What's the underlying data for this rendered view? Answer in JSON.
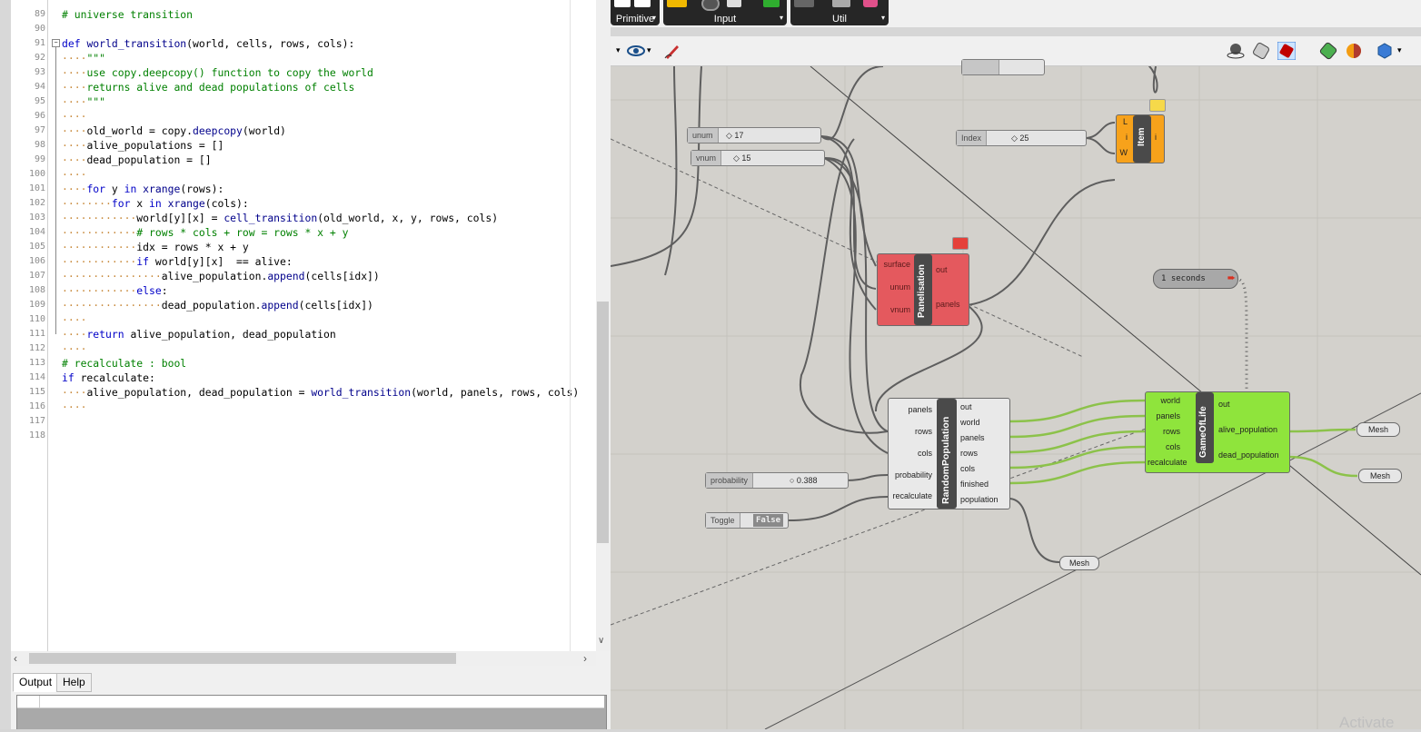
{
  "editor": {
    "lines": [
      {
        "n": "89",
        "code": [
          [
            "cm",
            "# universe transition"
          ]
        ]
      },
      {
        "n": "90",
        "code": []
      },
      {
        "n": "91",
        "code": [
          [
            "kw",
            "def "
          ],
          [
            "fn",
            "world_transition"
          ],
          [
            "",
            "(world, cells, rows, cols):"
          ]
        ]
      },
      {
        "n": "92",
        "code": [
          [
            "ws",
            "····"
          ],
          [
            "st",
            "\"\"\""
          ]
        ]
      },
      {
        "n": "93",
        "code": [
          [
            "ws",
            "····"
          ],
          [
            "cm",
            "use copy.deepcopy() function to copy the world"
          ]
        ]
      },
      {
        "n": "94",
        "code": [
          [
            "ws",
            "····"
          ],
          [
            "cm",
            "returns alive and dead populations of cells"
          ]
        ]
      },
      {
        "n": "95",
        "code": [
          [
            "ws",
            "····"
          ],
          [
            "st",
            "\"\"\""
          ]
        ]
      },
      {
        "n": "96",
        "code": [
          [
            "ws",
            "····"
          ]
        ]
      },
      {
        "n": "97",
        "code": [
          [
            "ws",
            "····"
          ],
          [
            "",
            "old_world = copy."
          ],
          [
            "fn",
            "deepcopy"
          ],
          [
            "",
            "(world)"
          ]
        ]
      },
      {
        "n": "98",
        "code": [
          [
            "ws",
            "····"
          ],
          [
            "",
            "alive_populations = []"
          ]
        ]
      },
      {
        "n": "99",
        "code": [
          [
            "ws",
            "····"
          ],
          [
            "",
            "dead_population = []"
          ]
        ]
      },
      {
        "n": "100",
        "code": [
          [
            "ws",
            "····"
          ]
        ]
      },
      {
        "n": "101",
        "code": [
          [
            "ws",
            "····"
          ],
          [
            "kw",
            "for"
          ],
          [
            "",
            " y "
          ],
          [
            "kw",
            "in"
          ],
          [
            "",
            " "
          ],
          [
            "fn",
            "xrange"
          ],
          [
            "",
            "(rows):"
          ]
        ]
      },
      {
        "n": "102",
        "code": [
          [
            "ws",
            "········"
          ],
          [
            "kw",
            "for"
          ],
          [
            "",
            " x "
          ],
          [
            "kw",
            "in"
          ],
          [
            "",
            " "
          ],
          [
            "fn",
            "xrange"
          ],
          [
            "",
            "(cols):"
          ]
        ]
      },
      {
        "n": "103",
        "code": [
          [
            "ws",
            "············"
          ],
          [
            "",
            "world[y][x] = "
          ],
          [
            "fn",
            "cell_transition"
          ],
          [
            "",
            "(old_world, x, y, rows, cols)"
          ]
        ]
      },
      {
        "n": "104",
        "code": [
          [
            "ws",
            "············"
          ],
          [
            "cm",
            "# rows * cols + row = rows * x + y"
          ]
        ]
      },
      {
        "n": "105",
        "code": [
          [
            "ws",
            "············"
          ],
          [
            "",
            "idx = rows * x + y"
          ]
        ]
      },
      {
        "n": "106",
        "code": [
          [
            "ws",
            "············"
          ],
          [
            "kw",
            "if"
          ],
          [
            "",
            " world[y][x]  == alive:"
          ]
        ]
      },
      {
        "n": "107",
        "code": [
          [
            "ws",
            "················"
          ],
          [
            "",
            "alive_population."
          ],
          [
            "fn",
            "append"
          ],
          [
            "",
            "(cells[idx])"
          ]
        ]
      },
      {
        "n": "108",
        "code": [
          [
            "ws",
            "············"
          ],
          [
            "kw",
            "else"
          ],
          [
            "",
            ":"
          ]
        ]
      },
      {
        "n": "109",
        "code": [
          [
            "ws",
            "················"
          ],
          [
            "",
            "dead_population."
          ],
          [
            "fn",
            "append"
          ],
          [
            "",
            "(cells[idx])"
          ]
        ]
      },
      {
        "n": "110",
        "code": [
          [
            "ws",
            "····"
          ]
        ]
      },
      {
        "n": "111",
        "code": [
          [
            "ws",
            "····"
          ],
          [
            "kw",
            "return"
          ],
          [
            "",
            " alive_population, dead_population"
          ]
        ]
      },
      {
        "n": "112",
        "code": [
          [
            "ws",
            "····"
          ]
        ]
      },
      {
        "n": "113",
        "code": [
          [
            "cm",
            "# recalculate : bool"
          ]
        ]
      },
      {
        "n": "114",
        "code": [
          [
            "kw",
            "if"
          ],
          [
            "",
            " recalculate:"
          ]
        ]
      },
      {
        "n": "115",
        "code": [
          [
            "ws",
            "····"
          ],
          [
            "",
            "alive_population, dead_population = "
          ],
          [
            "fn",
            "world_transition"
          ],
          [
            "",
            "(world, panels, rows, cols)"
          ]
        ]
      },
      {
        "n": "116",
        "code": [
          [
            "ws",
            "····"
          ]
        ]
      },
      {
        "n": "117",
        "code": []
      },
      {
        "n": "118",
        "code": []
      }
    ],
    "tabs": [
      "Output",
      "Help"
    ]
  },
  "toolbar": {
    "groups": [
      "Primitive",
      "Input",
      "Util"
    ]
  },
  "canvas": {
    "sliders": {
      "unum": {
        "label": "unum",
        "value": "◇ 17"
      },
      "vnum": {
        "label": "vnum",
        "value": "◇ 15"
      },
      "index": {
        "label": "Index",
        "value": "◇ 25"
      },
      "probability": {
        "label": "probability",
        "value": "○ 0.388"
      }
    },
    "toggle": {
      "label": "Toggle",
      "value": "False"
    },
    "timer": {
      "label": "1 seconds"
    },
    "item": {
      "title": "Item",
      "inputs": [
        "L",
        "i",
        "W"
      ],
      "outputs": [
        "i"
      ]
    },
    "panelisation": {
      "title": "Panelisation",
      "inputs": [
        "surface",
        "unum",
        "vnum"
      ],
      "outputs": [
        "out",
        "panels"
      ]
    },
    "random_population": {
      "title": "RandomPopulation",
      "inputs": [
        "panels",
        "rows",
        "cols",
        "probability",
        "recalculate"
      ],
      "outputs": [
        "out",
        "world",
        "panels",
        "rows",
        "cols",
        "finished",
        "population"
      ]
    },
    "game_of_life": {
      "title": "GameOfLife",
      "inputs": [
        "world",
        "panels",
        "rows",
        "cols",
        "recalculate"
      ],
      "outputs": [
        "out",
        "alive_population",
        "dead_population"
      ]
    },
    "mesh_label": "Mesh"
  },
  "watermark": "Activate"
}
